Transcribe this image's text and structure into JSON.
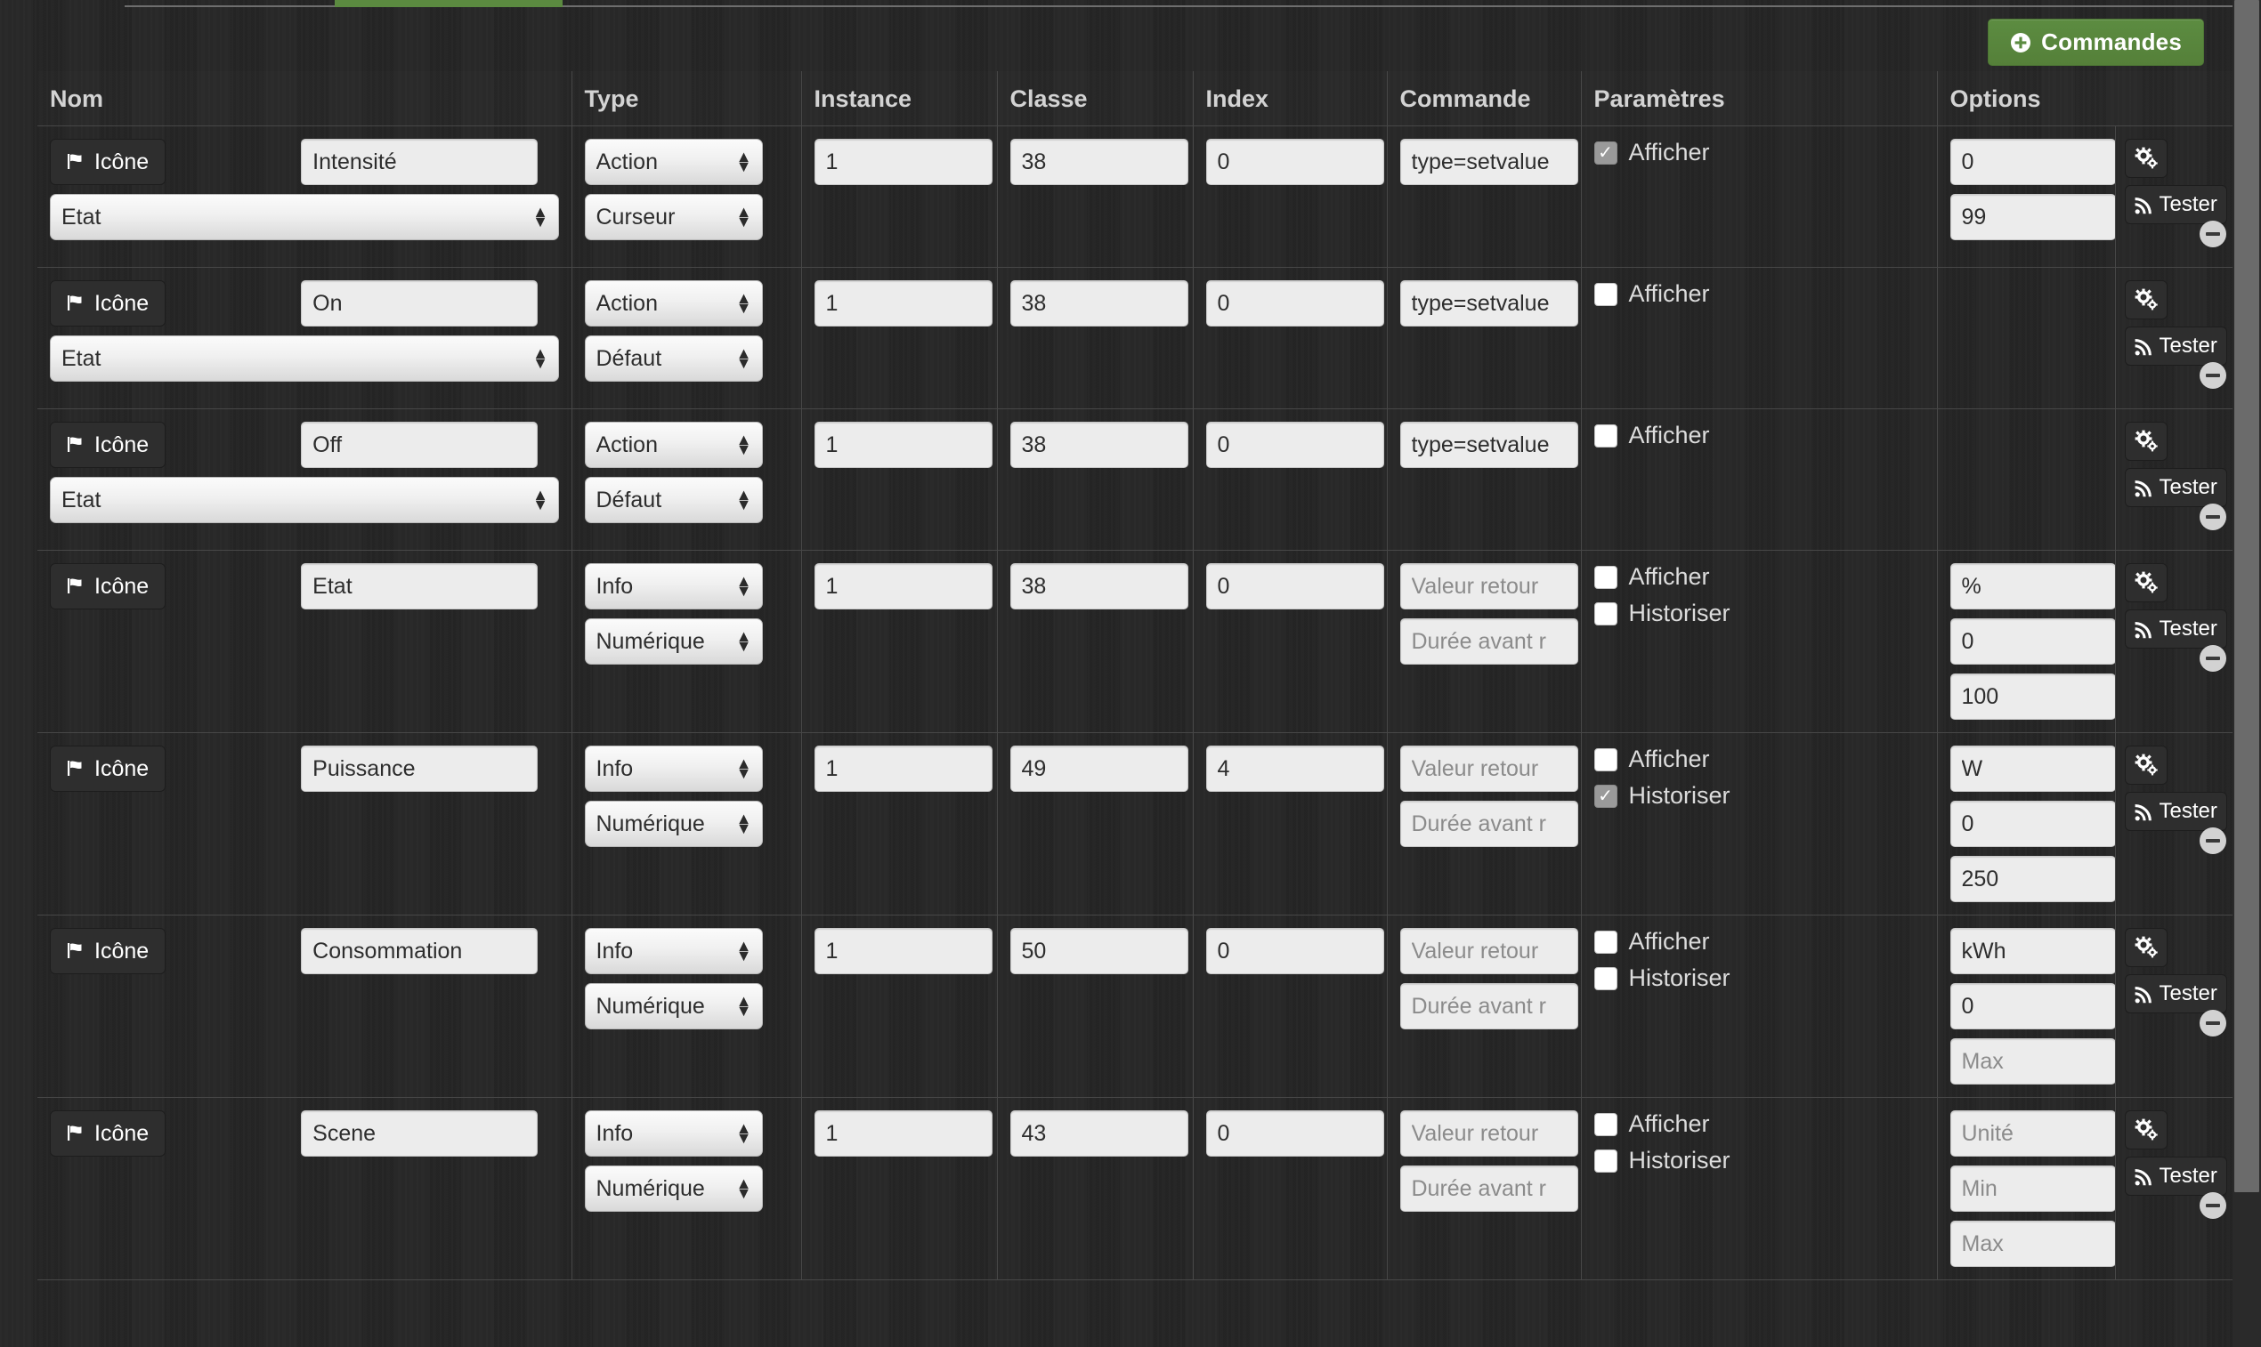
{
  "tabs": {
    "active_indicator": true
  },
  "toolbar": {
    "commandes_label": "Commandes",
    "commandes_icon": "plus-circle-icon",
    "accent_color": "#5b8a40"
  },
  "table": {
    "headers": {
      "nom": "Nom",
      "type": "Type",
      "instance": "Instance",
      "classe": "Classe",
      "index": "Index",
      "commande": "Commande",
      "parametres": "Paramètres",
      "options": "Options",
      "actions": ""
    },
    "common": {
      "icone_label": "Icône",
      "icone_icon": "flag-icon",
      "tester_label": "Tester",
      "tester_icon": "rss-icon",
      "config_icon": "gears-icon",
      "remove_icon": "minus-circle-icon",
      "afficher_label": "Afficher",
      "historiser_label": "Historiser",
      "valeur_retour_placeholder": "Valeur retour",
      "duree_avant_placeholder": "Durée avant r",
      "unite_placeholder": "Unité",
      "min_placeholder": "Min",
      "max_placeholder": "Max"
    },
    "rows": [
      {
        "nom": "Intensité",
        "etat_select": "Etat",
        "type": "Action",
        "subtype": "Curseur",
        "instance": "1",
        "classe": "38",
        "index": "0",
        "commande": "type=setvalue",
        "commande_readonly": false,
        "afficher": true,
        "afficher_visible": true,
        "historiser": false,
        "historiser_visible": false,
        "options": [
          {
            "value": "0",
            "placeholder": ""
          },
          {
            "value": "99",
            "placeholder": ""
          }
        ]
      },
      {
        "nom": "On",
        "etat_select": "Etat",
        "type": "Action",
        "subtype": "Défaut",
        "instance": "1",
        "classe": "38",
        "index": "0",
        "commande": "type=setvalue",
        "commande_readonly": false,
        "afficher": false,
        "afficher_visible": true,
        "historiser": false,
        "historiser_visible": false,
        "options": []
      },
      {
        "nom": "Off",
        "etat_select": "Etat",
        "type": "Action",
        "subtype": "Défaut",
        "instance": "1",
        "classe": "38",
        "index": "0",
        "commande": "type=setvalue",
        "commande_readonly": false,
        "afficher": false,
        "afficher_visible": true,
        "historiser": false,
        "historiser_visible": false,
        "options": []
      },
      {
        "nom": "Etat",
        "etat_select": null,
        "type": "Info",
        "subtype": "Numérique",
        "instance": "1",
        "classe": "38",
        "index": "0",
        "commande": "",
        "commande_readonly": true,
        "afficher": false,
        "afficher_visible": true,
        "historiser": false,
        "historiser_visible": true,
        "options": [
          {
            "value": "%",
            "placeholder": "Unité"
          },
          {
            "value": "0",
            "placeholder": "Min"
          },
          {
            "value": "100",
            "placeholder": "Max"
          }
        ]
      },
      {
        "nom": "Puissance",
        "etat_select": null,
        "type": "Info",
        "subtype": "Numérique",
        "instance": "1",
        "classe": "49",
        "index": "4",
        "commande": "",
        "commande_readonly": true,
        "afficher": false,
        "afficher_visible": true,
        "historiser": true,
        "historiser_visible": true,
        "options": [
          {
            "value": "W",
            "placeholder": "Unité"
          },
          {
            "value": "0",
            "placeholder": "Min"
          },
          {
            "value": "250",
            "placeholder": "Max"
          }
        ]
      },
      {
        "nom": "Consommation",
        "etat_select": null,
        "type": "Info",
        "subtype": "Numérique",
        "instance": "1",
        "classe": "50",
        "index": "0",
        "commande": "",
        "commande_readonly": true,
        "afficher": false,
        "afficher_visible": true,
        "historiser": false,
        "historiser_visible": true,
        "options": [
          {
            "value": "kWh",
            "placeholder": "Unité"
          },
          {
            "value": "0",
            "placeholder": "Min"
          },
          {
            "value": "",
            "placeholder": "Max"
          }
        ]
      },
      {
        "nom": "Scene",
        "etat_select": null,
        "type": "Info",
        "subtype": "Numérique",
        "instance": "1",
        "classe": "43",
        "index": "0",
        "commande": "",
        "commande_readonly": true,
        "afficher": false,
        "afficher_visible": true,
        "historiser": false,
        "historiser_visible": true,
        "options": [
          {
            "value": "",
            "placeholder": "Unité"
          },
          {
            "value": "",
            "placeholder": "Min"
          },
          {
            "value": "",
            "placeholder": "Max"
          }
        ]
      }
    ]
  }
}
